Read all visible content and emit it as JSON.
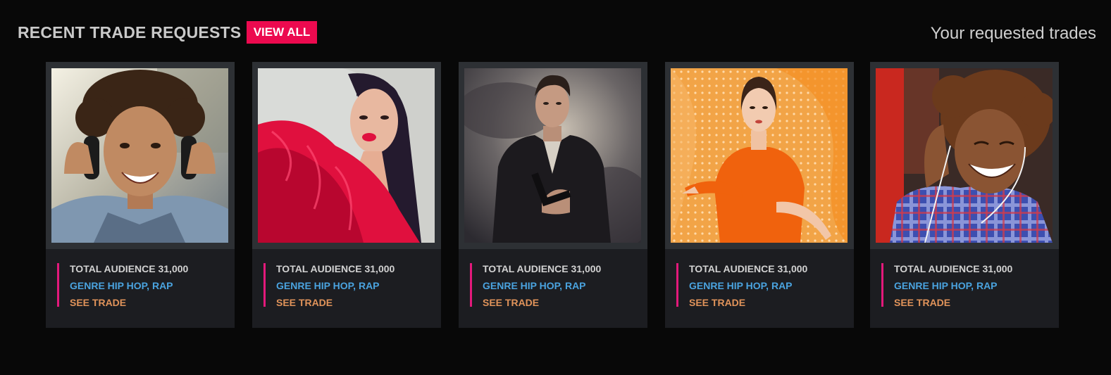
{
  "header": {
    "title": "RECENT TRADE REQUESTS",
    "view_all_label": "VIEW ALL",
    "requested_trades_link": "Your requested trades"
  },
  "colors": {
    "accent": "#ec0a4f",
    "card_border_accent": "#e3197b",
    "genre_text": "#4aa3df",
    "see_trade_text": "#e0935a",
    "background": "#080808",
    "card_background": "#1c1d21"
  },
  "cards": [
    {
      "photo": "young man with curly hair and headphones, smiling, denim jacket",
      "audience": "TOTAL AUDIENCE 31,000",
      "genre": "GENRE HIP HOP, RAP",
      "see_trade": "SEE TRADE"
    },
    {
      "photo": "woman with long dark hair and red lips in a red tulle dress",
      "audience": "TOTAL AUDIENCE 31,000",
      "genre": "GENRE HIP HOP, RAP",
      "see_trade": "SEE TRADE"
    },
    {
      "photo": "man in a dark suit against a cloudy sky",
      "audience": "TOTAL AUDIENCE 31,000",
      "genre": "GENRE HIP HOP, RAP",
      "see_trade": "SEE TRADE"
    },
    {
      "photo": "woman in an orange top against an orange polka-dot backdrop",
      "audience": "TOTAL AUDIENCE 31,000",
      "genre": "GENRE HIP HOP, RAP",
      "see_trade": "SEE TRADE"
    },
    {
      "photo": "laughing man with curly hair and earphones, plaid shirt",
      "audience": "TOTAL AUDIENCE 31,000",
      "genre": "GENRE HIP HOP, RAP",
      "see_trade": "SEE TRADE"
    }
  ]
}
